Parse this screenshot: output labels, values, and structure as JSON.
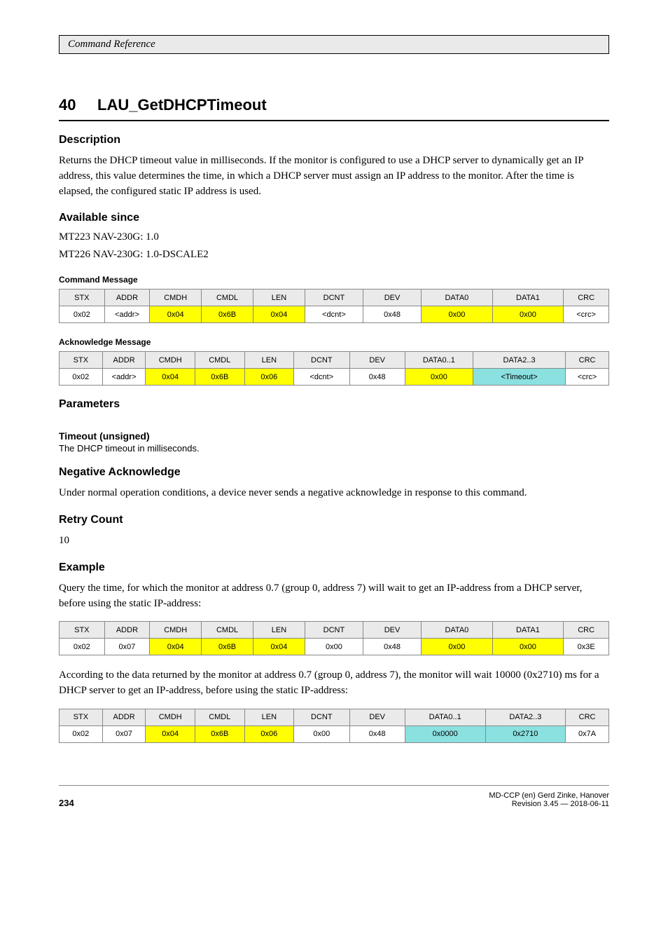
{
  "header": {
    "title": "Command Reference"
  },
  "section": {
    "number": "40",
    "name": "LAU_GetDHCPTimeout",
    "desc_head": "Description",
    "desc": "Returns the DHCP timeout value in milliseconds. If the monitor is configured to use a DHCP server to dynamically get an IP address, this value determines the time, in which a DHCP server must assign an IP address to the monitor. After the time is elapsed, the configured static IP address is used.",
    "since_head": "Available since",
    "since_lines": [
      "MT223 NAV-230G: 1.0",
      "MT226 NAV-230G: 1.0-DSCALE2"
    ],
    "cmd_caption": "Command Message",
    "ack_caption": "Acknowledge Message",
    "headers": [
      "STX",
      "ADDR",
      "CMDH",
      "CMDL",
      "LEN",
      "DCNT",
      "DEV",
      "DATA0",
      "DATA1",
      "CRC"
    ],
    "ack2_headers": [
      "STX",
      "ADDR",
      "CMDH",
      "CMDL",
      "LEN",
      "DCNT",
      "DEV",
      "DATA0..1",
      "DATA2..3",
      "CRC"
    ],
    "cmd_row": {
      "stx": "0x02",
      "addr": "<addr>",
      "cmdh": "0x04",
      "cmdl": "0x6B",
      "len": "0x04",
      "dcnt": "<dcnt>",
      "dev": "0x48",
      "d0": "0x00",
      "d1": "0x00",
      "crc": "<crc>"
    },
    "ack_row": {
      "stx": "0x02",
      "addr": "<addr>",
      "cmdh": "0x04",
      "cmdl": "0x6B",
      "len": "0x06",
      "dcnt": "<dcnt>",
      "dev": "0x48",
      "d0": "0x00",
      "d1": "<Timeout>",
      "crc": "<crc>"
    },
    "params_head": "Parameters",
    "param_name": "Timeout (unsigned)",
    "param_desc": "The DHCP timeout in milliseconds.",
    "nack_head": "Negative Acknowledge",
    "nack_text": "Under normal operation conditions, a device never sends a negative acknowledge in response to this command.",
    "retry_head": "Retry Count",
    "retry_text": "10",
    "example_head": "Example",
    "example1_text": "Query the time, for which the monitor at address 0.7 (group 0, address 7) will wait to get an IP-address from a DHCP server, before using the static IP-address:",
    "example1_row": {
      "stx": "0x02",
      "addr": "0x07",
      "cmdh": "0x04",
      "cmdl": "0x6B",
      "len": "0x04",
      "dcnt": "0x00",
      "dev": "0x48",
      "d0": "0x00",
      "d1": "0x00",
      "crc": "0x3E"
    },
    "example2_text": "According to the data returned by the monitor at address 0.7 (group 0, address 7), the monitor will wait 10000 (0x2710) ms for a DHCP server to get an IP-address, before using the static IP-address:",
    "example2_row": {
      "stx": "0x02",
      "addr": "0x07",
      "cmdh": "0x04",
      "cmdl": "0x6B",
      "len": "0x06",
      "dcnt": "0x00",
      "dev": "0x48",
      "d0": "0x0000",
      "d1": "0x2710",
      "crc": "0x7A"
    }
  },
  "footer": {
    "page": "234",
    "doc": "MD-CCP (en) Gerd Zinke, Hanover",
    "rev": "Revision 3.45 —  2018-06-11"
  }
}
